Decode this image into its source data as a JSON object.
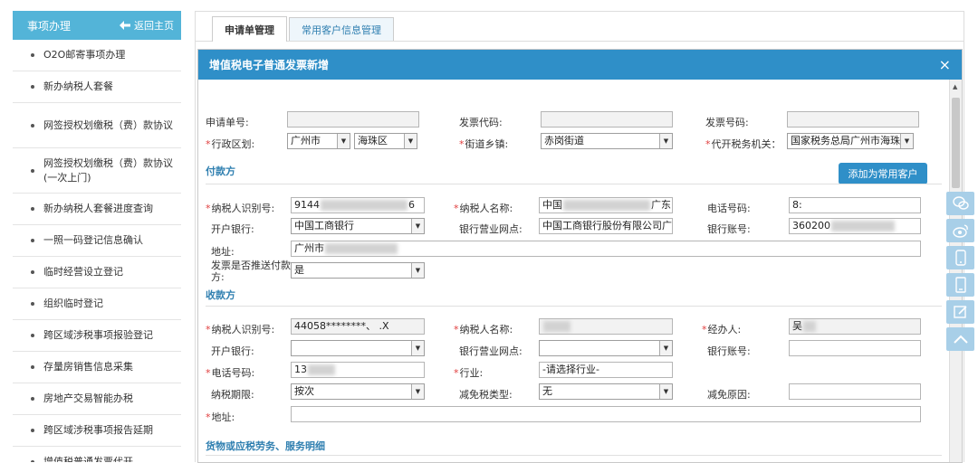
{
  "sidebar": {
    "title": "事项办理",
    "back_label": "返回主页",
    "items": [
      {
        "label": "O2O邮寄事项办理"
      },
      {
        "label": "新办纳税人套餐"
      },
      {
        "label": "网签授权划缴税（费）款协议"
      },
      {
        "label": "网签授权划缴税（费）款协议(一次上门)"
      },
      {
        "label": "新办纳税人套餐进度查询"
      },
      {
        "label": "一照一码登记信息确认"
      },
      {
        "label": "临时经营设立登记"
      },
      {
        "label": "组织临时登记"
      },
      {
        "label": "跨区域涉税事项报验登记"
      },
      {
        "label": "存量房销售信息采集"
      },
      {
        "label": "房地产交易智能办税"
      },
      {
        "label": "跨区域涉税事项报告延期"
      },
      {
        "label": "增值税普通发票代开"
      }
    ]
  },
  "tabs": [
    {
      "label": "申请单管理"
    },
    {
      "label": "常用客户信息管理"
    }
  ],
  "dialog": {
    "title": "增值税电子普通发票新增",
    "close": "×"
  },
  "form": {
    "sq_no": "申请单号:",
    "fp_code": "发票代码:",
    "fp_no": "发票号码:",
    "region_label": "行政区划:",
    "region_city": "广州市",
    "region_district": "海珠区",
    "street_label": "街道乡镇:",
    "street_value": "赤岗街道",
    "agency_label": "代开税务机关：",
    "agency_value": "国家税务总局广州市海珠",
    "payer_section": "付款方",
    "add_customer": "添加为常用客户",
    "payer_taxid_label": "纳税人识别号:",
    "payer_taxid_a": "9144",
    "payer_taxid_b": "6",
    "payer_name_label": "纳税人名称:",
    "payer_name_a": "中国",
    "payer_name_b": "广东",
    "payer_phone_label": "电话号码:",
    "payer_phone": "8:",
    "payer_bank_label": "开户银行:",
    "payer_bank": "中国工商银行",
    "payer_branch_label": "银行营业网点:",
    "payer_branch": "中国工商银行股份有限公司广州",
    "payer_acct_label": "银行账号:",
    "payer_acct": "360200",
    "payer_addr_label": "地址:",
    "payer_addr": "广州市",
    "push_label_1": "发票是否推送付款",
    "push_label_2": "方:",
    "push_value": "是",
    "payee_section": "收款方",
    "payee_taxid_label": "纳税人识别号:",
    "payee_taxid": "44058********、  .X",
    "payee_name_label": "纳税人名称:",
    "handler_label": "经办人:",
    "handler": "吴",
    "payee_bank_label": "开户银行:",
    "payee_branch_label": "银行营业网点:",
    "payee_acct_label": "银行账号:",
    "payee_phone_label": "电话号码:",
    "payee_phone": "13",
    "industry_label": "行业:",
    "industry_value": "-请选择行业-",
    "period_label": "纳税期限:",
    "period_value": "按次",
    "relief_type_label": "减免税类型:",
    "relief_type_value": "无",
    "relief_reason_label": "减免原因:",
    "addr_label": "地址:",
    "goods_section": "货物或应税劳务、服务明细"
  },
  "floats": [
    {
      "icon": "wechat-icon"
    },
    {
      "icon": "weibo-icon"
    },
    {
      "icon": "phone-icon"
    },
    {
      "icon": "tablet-icon"
    },
    {
      "icon": "edit-icon"
    },
    {
      "icon": "top-icon"
    }
  ]
}
